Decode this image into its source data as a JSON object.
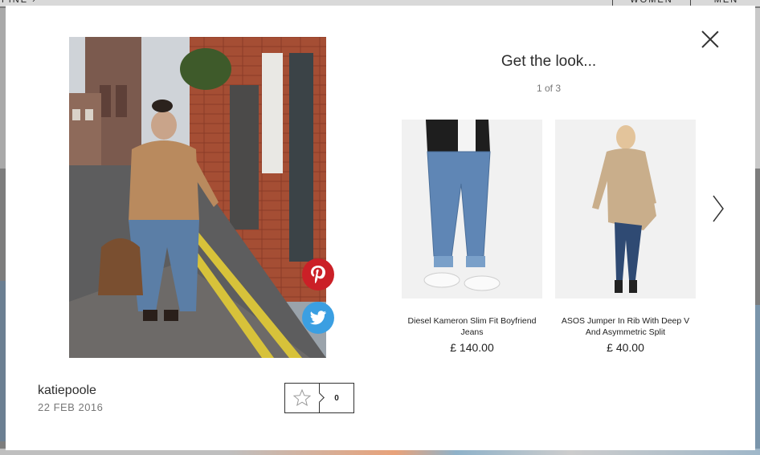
{
  "background": {
    "nav_left": "FINE ›",
    "nav_women": "WOMEN",
    "nav_men": "MEN"
  },
  "modal": {
    "close_icon": "close-icon",
    "photo": {
      "alt": "Woman in tan sweater and jeans on cobbled street",
      "share": {
        "pinterest_icon": "pinterest-icon",
        "twitter_icon": "twitter-icon"
      }
    },
    "author": {
      "name": "katiepoole",
      "date": "22 FEB 2016"
    },
    "like": {
      "icon": "star-icon",
      "count": "0"
    },
    "look": {
      "title": "Get the look...",
      "pager": "1 of 3",
      "products": [
        {
          "name": "Diesel Kameron Slim Fit Boyfriend Jeans",
          "price": "£ 140.00"
        },
        {
          "name": "ASOS Jumper In Rib With Deep V And Asymmetric Split",
          "price": "£ 40.00"
        }
      ],
      "next_icon": "chevron-right-icon"
    }
  },
  "colors": {
    "pinterest": "#cb2027",
    "twitter": "#3b9fe2",
    "overlay": "#7d7d7d"
  }
}
